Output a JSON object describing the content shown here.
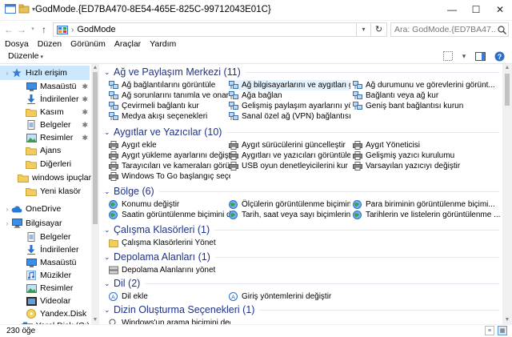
{
  "window": {
    "title": "GodMode.{ED7BA470-8E54-465E-825C-99712043E01C}",
    "min": "—",
    "max": "☐",
    "close": "✕"
  },
  "address": {
    "crumb": "GodMode",
    "search_placeholder": "Ara: GodMode.{ED7BA47..."
  },
  "menu": [
    "Dosya",
    "Düzen",
    "Görünüm",
    "Araçlar",
    "Yardım"
  ],
  "toolbar": {
    "organize": "Düzenle"
  },
  "nav": {
    "items": [
      {
        "label": "Hızlı erişim",
        "icon": "star-icon",
        "selected": true
      },
      {
        "label": "Masaüstü",
        "icon": "desktop-icon",
        "pinned": true
      },
      {
        "label": "İndirilenler",
        "icon": "download-icon",
        "pinned": true
      },
      {
        "label": "Kasım",
        "icon": "folder-icon",
        "pinned": true
      },
      {
        "label": "Belgeler",
        "icon": "documents-icon",
        "pinned": true
      },
      {
        "label": "Resimler",
        "icon": "pictures-icon",
        "pinned": true
      },
      {
        "label": "Ajans",
        "icon": "folder-icon"
      },
      {
        "label": "Diğerleri",
        "icon": "folder-icon"
      },
      {
        "label": "windows ipuçlar",
        "icon": "folder-icon"
      },
      {
        "label": "Yeni klasör",
        "icon": "folder-icon"
      },
      {
        "label": "OneDrive",
        "icon": "cloud-icon"
      },
      {
        "label": "Bilgisayar",
        "icon": "computer-icon"
      },
      {
        "label": "Belgeler",
        "icon": "documents-icon"
      },
      {
        "label": "İndirilenler",
        "icon": "download-icon"
      },
      {
        "label": "Masaüstü",
        "icon": "desktop-icon"
      },
      {
        "label": "Müzikler",
        "icon": "music-icon"
      },
      {
        "label": "Resimler",
        "icon": "pictures-icon"
      },
      {
        "label": "Videolar",
        "icon": "video-icon"
      },
      {
        "label": "Yandex.Disk",
        "icon": "disk-icon"
      },
      {
        "label": "Yerel Disk (C:)",
        "icon": "drive-icon"
      }
    ],
    "pin_glyph": "✱"
  },
  "groups": [
    {
      "title": "Ağ ve Paylaşım Merkezi (11)",
      "tasks": [
        "Ağ bağlantılarını görüntüle",
        "Ağ bilgisayarlarını ve aygıtları görünt...",
        "Ağ durumunu ve görevlerini görünt...",
        "Ağ sorunlarını tanımla ve onar",
        "Ağa bağlan",
        "Bağlantı veya ağ kur",
        "Çevirmeli bağlantı kur",
        "Gelişmiş paylaşım ayarlarını yönet",
        "Geniş bant bağlantısı kurun",
        "Medya akışı seçenekleri",
        "Sanal özel ağ (VPN) bağlantısı kur"
      ]
    },
    {
      "title": "Aygıtlar ve Yazıcılar (10)",
      "tasks": [
        "Aygıt ekle",
        "Aygıt sürücülerini güncelleştir",
        "Aygıt Yöneticisi",
        "Aygıt yükleme ayarlarını değiştir",
        "Aygıtları ve yazıcıları görüntüle",
        "Gelişmiş yazıcı kurulumu",
        "Tarayıcıları ve kameraları görüntüle",
        "USB oyun denetleyicilerini kur",
        "Varsayılan yazıcıyı değiştir",
        "Windows To Go başlangıç seçenekle..."
      ]
    },
    {
      "title": "Bölge (6)",
      "tasks": [
        "Konumu değiştir",
        "Ölçülerin görüntülenme biçimini de...",
        "Para biriminin görüntülenme biçimi...",
        "Saatin görüntülenme biçimini değiştir",
        "Tarih, saat veya sayı biçimlerini değiş...",
        "Tarihlerin ve listelerin görüntülenme ..."
      ]
    },
    {
      "title": "Çalışma Klasörleri (1)",
      "tasks": [
        "Çalışma Klasörlerini Yönet"
      ]
    },
    {
      "title": "Depolama Alanları (1)",
      "tasks": [
        "Depolama Alanlarını yönet"
      ]
    },
    {
      "title": "Dil (2)",
      "tasks": [
        "Dil ekle",
        "Giriş yöntemlerini değiştir"
      ]
    },
    {
      "title": "Dizin Oluşturma Seçenekleri (1)",
      "tasks": [
        "Windows'un arama biçimini değiştir"
      ]
    }
  ],
  "status": {
    "count": "230 öğe"
  }
}
